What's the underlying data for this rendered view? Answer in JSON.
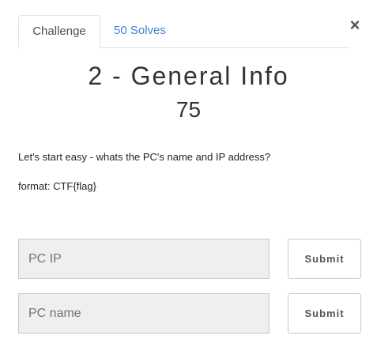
{
  "tabs": [
    {
      "label": "Challenge",
      "active": true
    },
    {
      "label": "50 Solves",
      "active": false
    }
  ],
  "close_label": "×",
  "challenge": {
    "title": "2 - General Info",
    "points": "75",
    "description": [
      "Let's start easy - whats the PC's name and IP address?",
      "format: CTF{flag}"
    ]
  },
  "inputs": [
    {
      "placeholder": "PC IP",
      "value": "",
      "submit_label": "Submit"
    },
    {
      "placeholder": "PC name",
      "value": "",
      "submit_label": "Submit"
    }
  ],
  "colors": {
    "link": "#3e86d8",
    "input_bg": "#efefef",
    "border": "#dee2e6"
  }
}
